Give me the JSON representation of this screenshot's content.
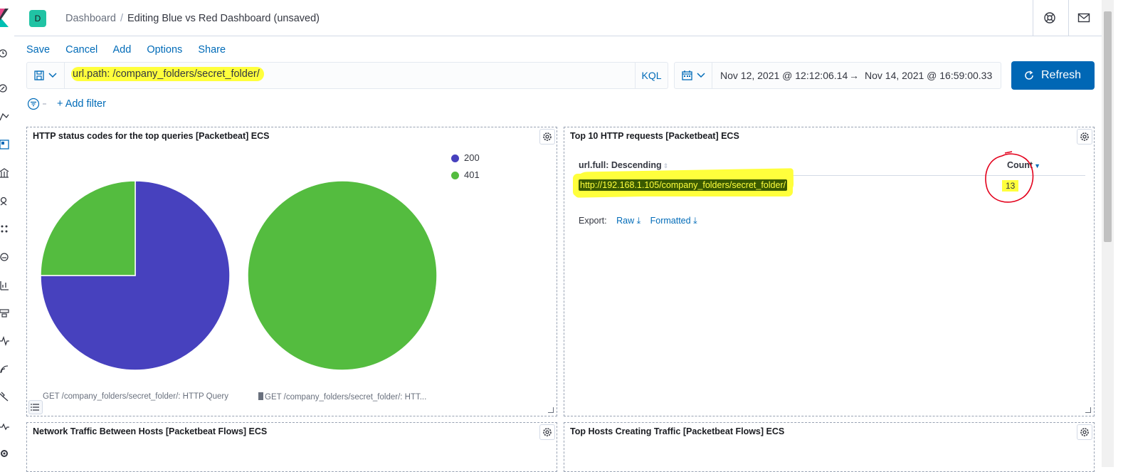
{
  "header": {
    "space_initial": "D",
    "breadcrumbs": [
      "Dashboard",
      "Editing Blue vs Red Dashboard (unsaved)"
    ],
    "icons": [
      "help-icon",
      "newsfeed-icon"
    ]
  },
  "nav_rail": {
    "icons": [
      "kibana-logo",
      "clock-icon",
      "discover-icon",
      "visualize-icon",
      "dashboard-icon",
      "canvas-icon",
      "maps-icon",
      "ml-icon",
      "metrics-icon",
      "logs-icon",
      "apm-icon",
      "uptime-icon",
      "siem-icon",
      "devtools-icon",
      "monitoring-icon",
      "management-icon"
    ]
  },
  "top_menu": {
    "save": "Save",
    "cancel": "Cancel",
    "add": "Add",
    "options": "Options",
    "share": "Share"
  },
  "query_bar": {
    "query": "url.path: /company_folders/secret_folder/",
    "language": "KQL"
  },
  "date_picker": {
    "start": "Nov 12, 2021 @ 12:12:06.14",
    "arrow": "→",
    "end": "Nov 14, 2021 @ 16:59:00.33"
  },
  "refresh_button": {
    "label": "Refresh"
  },
  "filters": {
    "add_filter": "+ Add filter"
  },
  "panels": {
    "status_codes": {
      "title": "HTTP status codes for the top queries [Packetbeat] ECS",
      "legend": [
        {
          "label": "200",
          "color": "#4741be"
        },
        {
          "label": "401",
          "color": "#54bc3f"
        }
      ],
      "captions": [
        "GET /company_folders/secret_folder/: HTTP Query",
        "GET /company_folders/secret_folder/: HTT..."
      ]
    },
    "top_requests": {
      "title": "Top 10 HTTP requests [Packetbeat] ECS",
      "columns": [
        "url.full: Descending",
        "Count"
      ],
      "rows": [
        {
          "url": "http://192.168.1.105/company_folders/secret_folder/",
          "count": "13"
        }
      ],
      "export_label": "Export:",
      "export_raw": "Raw",
      "export_formatted": "Formatted"
    },
    "network_traffic": {
      "title": "Network Traffic Between Hosts [Packetbeat Flows] ECS"
    },
    "top_hosts": {
      "title": "Top Hosts Creating Traffic [Packetbeat Flows] ECS"
    }
  },
  "chart_data": [
    {
      "type": "pie",
      "title": "",
      "slices": [
        {
          "label": "200",
          "value": 75,
          "color": "#4741be"
        },
        {
          "label": "401",
          "value": 25,
          "color": "#54bc3f"
        }
      ],
      "caption": "GET /company_folders/secret_folder/: HTTP Query"
    },
    {
      "type": "pie",
      "title": "",
      "slices": [
        {
          "label": "401",
          "value": 100,
          "color": "#54bc3f"
        }
      ],
      "caption": "GET /company_folders/secret_folder/: HTT..."
    }
  ]
}
